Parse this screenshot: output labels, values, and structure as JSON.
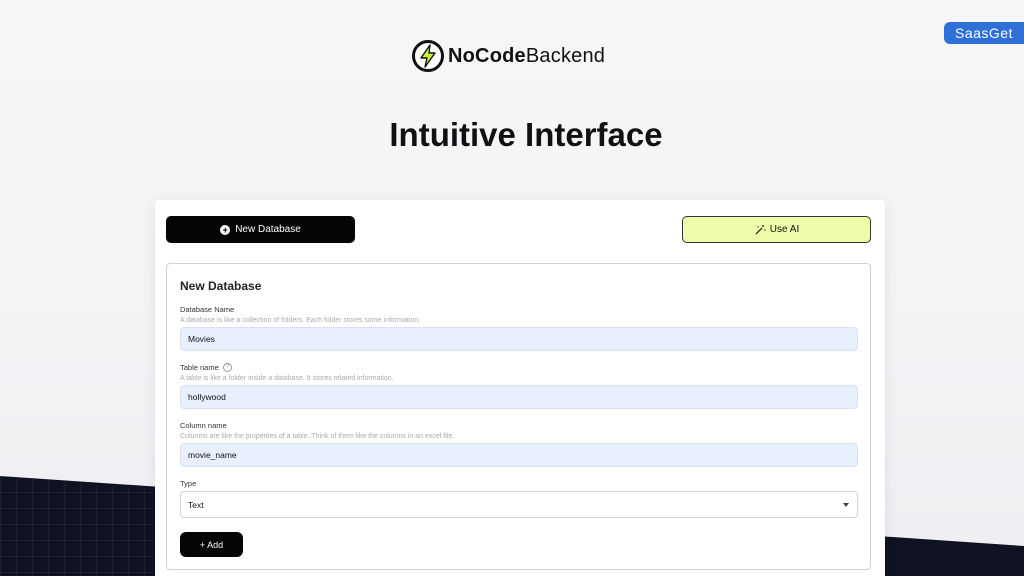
{
  "badge": {
    "text": "SaasGet"
  },
  "logo": {
    "bold": "NoCode",
    "regular": "Backend",
    "icon": "lightning-bolt-icon"
  },
  "headline": "Intuitive Interface",
  "toolbar": {
    "new_database_label": "New Database",
    "new_database_icon": "plus-circle-icon",
    "use_ai_label": "Use AI",
    "use_ai_icon": "magic-wand-icon",
    "use_ai_color": "#eefcaa"
  },
  "form": {
    "title": "New Database",
    "database_name": {
      "label": "Database Name",
      "hint": "A database is like a collection of folders. Each folder stores some information.",
      "value": "Movies"
    },
    "table_name": {
      "label": "Table name",
      "hint": "A table is like a folder inside a database. It stores related information.",
      "value": "hollywood",
      "help_icon": "help-circle-icon"
    },
    "column_name": {
      "label": "Column name",
      "hint": "Columns are like the properties of a table. Think of them like the columns in an excel file.",
      "value": "movie_name"
    },
    "type": {
      "label": "Type",
      "value": "Text"
    },
    "add_label": "+ Add"
  },
  "colors": {
    "input_bg": "#e9f0fd",
    "badge_bg": "#2f6fd8",
    "dark_bg": "#0f1220"
  }
}
